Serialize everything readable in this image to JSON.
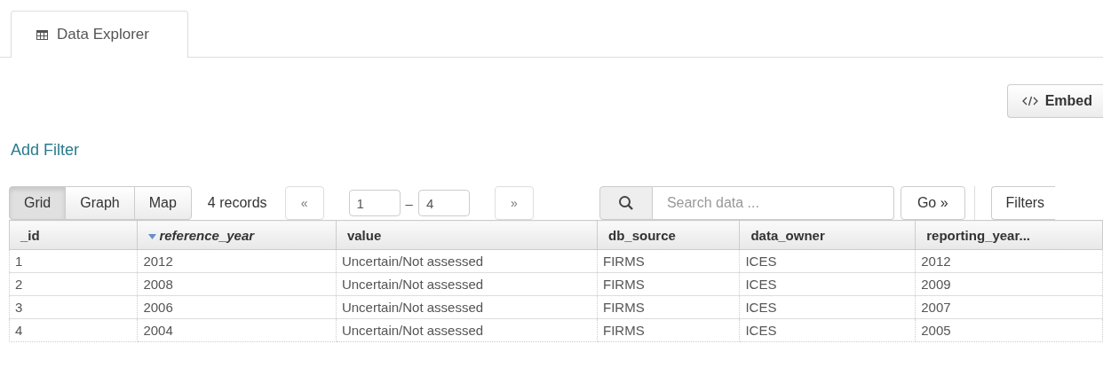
{
  "tabs": [
    {
      "label": "Data Explorer",
      "selected": true
    }
  ],
  "embed_button": {
    "label": "Embed"
  },
  "add_filter": "Add Filter",
  "views": [
    {
      "label": "Grid",
      "selected": true
    },
    {
      "label": "Graph",
      "selected": false
    },
    {
      "label": "Map",
      "selected": false
    }
  ],
  "record_count": "4 records",
  "pager": {
    "prev": "«",
    "from": "1",
    "separator": "–",
    "to": "4",
    "next": "»"
  },
  "search": {
    "placeholder": "Search data ...",
    "button": "Go »"
  },
  "filters_button": "Filters",
  "table": {
    "columns": [
      {
        "label": "_id",
        "sorted": false
      },
      {
        "label": "reference_year",
        "sorted": true
      },
      {
        "label": "value",
        "sorted": false
      },
      {
        "label": "db_source",
        "sorted": false
      },
      {
        "label": "data_owner",
        "sorted": false
      },
      {
        "label": "reporting_year...",
        "sorted": false
      }
    ],
    "rows": [
      [
        "1",
        "2012",
        "Uncertain/Not assessed",
        "FIRMS",
        "ICES",
        "2012"
      ],
      [
        "2",
        "2008",
        "Uncertain/Not assessed",
        "FIRMS",
        "ICES",
        "2009"
      ],
      [
        "3",
        "2006",
        "Uncertain/Not assessed",
        "FIRMS",
        "ICES",
        "2007"
      ],
      [
        "4",
        "2004",
        "Uncertain/Not assessed",
        "FIRMS",
        "ICES",
        "2005"
      ]
    ]
  }
}
